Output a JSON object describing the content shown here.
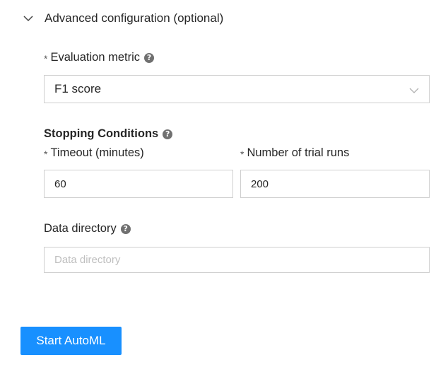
{
  "section": {
    "title": "Advanced configuration (optional)",
    "expanded": true,
    "icon": "chevron-down-icon"
  },
  "evaluation_metric": {
    "required_mark": "*",
    "label": "Evaluation metric",
    "selected": "F1 score",
    "help_icon": "question-circle-icon"
  },
  "stopping_conditions": {
    "heading": "Stopping Conditions",
    "help_icon": "question-circle-icon",
    "timeout": {
      "required_mark": "*",
      "label": "Timeout (minutes)",
      "value": "60"
    },
    "trial_runs": {
      "required_mark": "*",
      "label": "Number of trial runs",
      "value": "200"
    }
  },
  "data_directory": {
    "label": "Data directory",
    "placeholder": "Data directory",
    "value": "",
    "help_icon": "question-circle-icon"
  },
  "actions": {
    "start_label": "Start AutoML"
  },
  "colors": {
    "primary": "#1890ff",
    "border": "#cfcfcf",
    "text": "#262626",
    "placeholder": "#bfbfbf",
    "help_icon_bg": "#707070"
  }
}
